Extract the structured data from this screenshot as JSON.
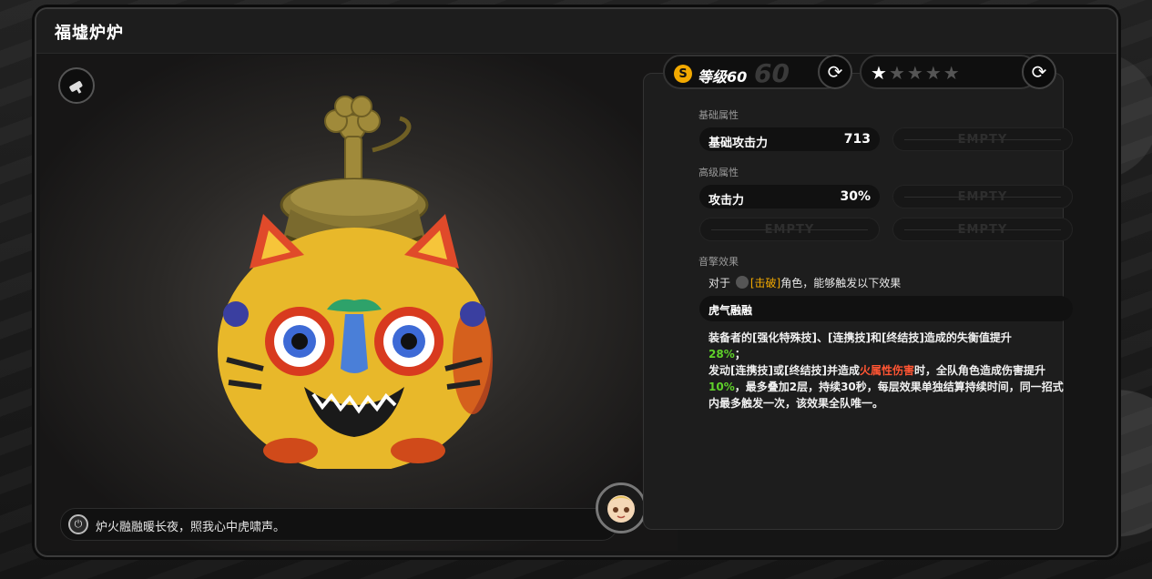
{
  "window": {
    "title": "福墟炉炉"
  },
  "quote": {
    "text": "炉火融融暖长夜，照我心中虎啸声。"
  },
  "level": {
    "label": "等级60",
    "max": "60",
    "rank_badge": "S"
  },
  "stars": {
    "filled": 1,
    "total": 5
  },
  "sections": {
    "base_label": "基础属性",
    "advanced_label": "高级属性",
    "effect_label": "音擎效果"
  },
  "stats": {
    "base": {
      "name": "基础攻击力",
      "value": "713"
    },
    "advanced": {
      "name": "攻击力",
      "value": "30%"
    },
    "empty_text": "EMPTY"
  },
  "effect": {
    "intro_prefix": "对于",
    "intro_highlight": "[击破]",
    "intro_suffix": "角色，能够触发以下效果",
    "name": "虎气融融",
    "desc_part1": "装备者的[强化特殊技]、[连携技]和[终结技]造成的失衡值提升",
    "desc_val1": "28%",
    "desc_part2": "；",
    "desc_part3": "发动[连携技]或[终结技]并造成",
    "desc_fire": "火属性伤害",
    "desc_part4": "时，全队角色造成伤害提升",
    "desc_val2": "10%",
    "desc_part5": "，最多叠加2层，持续30秒，每层效果单独结算持续时间，同一招式内最多触发一次，该效果全队唯一。"
  },
  "colors": {
    "accent_gold": "#f2a900",
    "green_value": "#5fd12a",
    "fire_red": "#ff5533"
  },
  "icons": [
    "strike-type-icon",
    "refresh-icon",
    "star-icon",
    "quote-icon",
    "avatar"
  ]
}
